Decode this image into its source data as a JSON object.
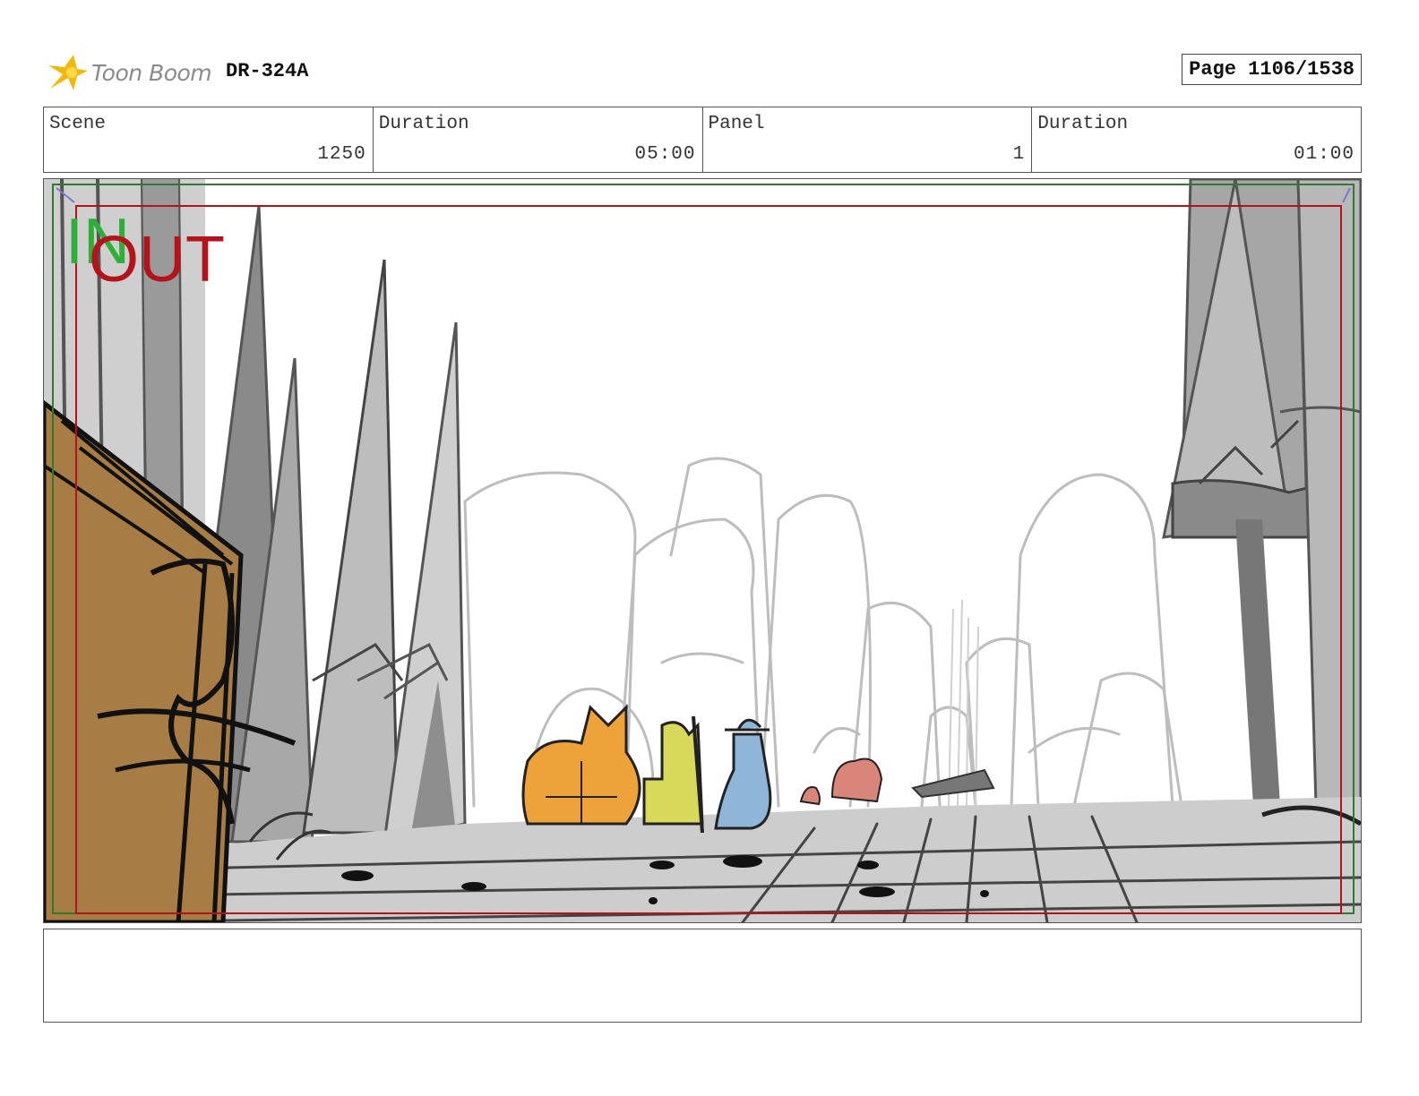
{
  "header": {
    "logo_text": "Toon Boom",
    "project_code": "DR-324A",
    "page_label": "Page 1106/1538"
  },
  "info": [
    {
      "label": "Scene",
      "value": "1250"
    },
    {
      "label": "Duration",
      "value": "05:00"
    },
    {
      "label": "Panel",
      "value": "1"
    },
    {
      "label": "Duration",
      "value": "01:00"
    }
  ],
  "panel": {
    "in_marker": "IN",
    "out_marker": "OUT",
    "colors": {
      "in": "#2fae3a",
      "out": "#b3141b",
      "safe_frame": "#2f7a2f",
      "action_frame": "#b3141b",
      "crate": "#a87d45",
      "char_orange": "#eea23a",
      "char_yellow": "#d8d85a",
      "char_blue": "#8fb6d9",
      "char_pink": "#d9857a"
    }
  },
  "notes": {
    "text": ""
  }
}
